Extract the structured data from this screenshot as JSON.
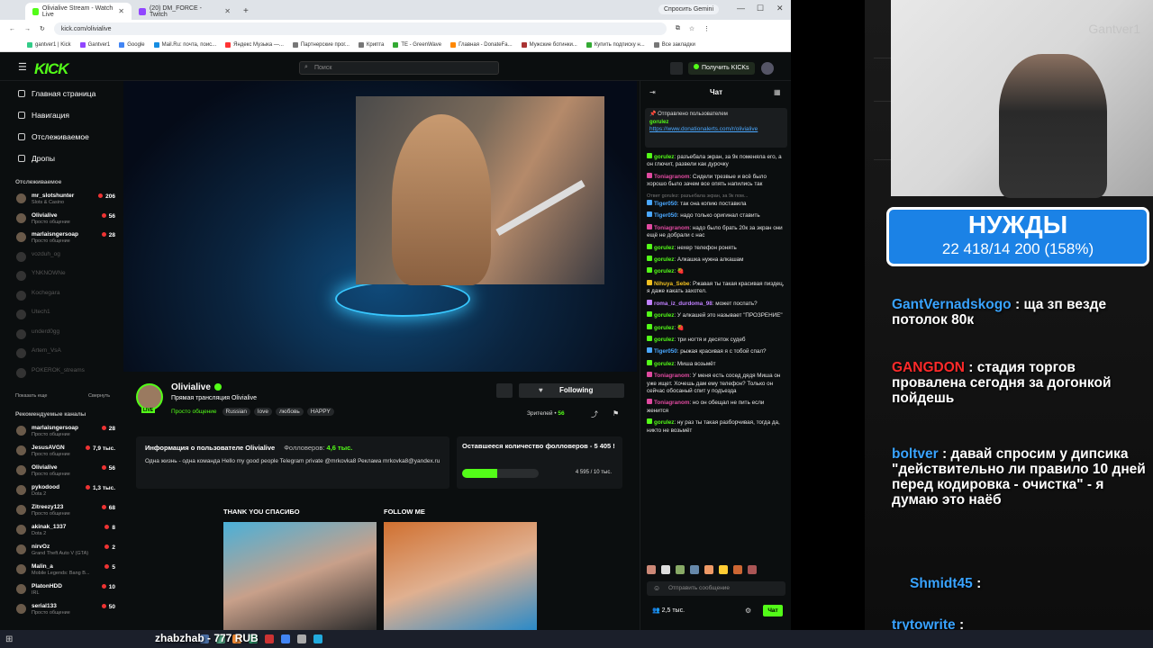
{
  "browser": {
    "tabs": [
      {
        "label": "Olivialive Stream - Watch Live",
        "color": "#53fc18"
      },
      {
        "label": "(20) DM_FORCE - Twitch",
        "color": "#9146ff"
      }
    ],
    "gemini": "Спросить Gemini",
    "url": "kick.com/olivialive",
    "bookmarks": [
      "gantver1 | Kick",
      "Gantver1",
      "Google",
      "Mail.Ru: почта, поис...",
      "Яндекс Музыка —...",
      "Партнерские прог...",
      "Крипта",
      "TE - GreenWave",
      "Главная - DonateFa...",
      "Мужские ботинки...",
      "Купить подписку н...",
      "Все закладки"
    ]
  },
  "kick": {
    "logo": "KICK",
    "search_placeholder": "Поиск",
    "get_kicks": "Получить KICKs"
  },
  "sidebar": {
    "nav": [
      "Главная страница",
      "Навигация",
      "Отслеживаемое",
      "Дропы"
    ],
    "followed_header": "Отслеживаемое",
    "followed": [
      {
        "name": "mr_slotshunter",
        "sub": "Slots & Casino",
        "count": "206",
        "live": true
      },
      {
        "name": "Olivialive",
        "sub": "Просто общение",
        "count": "56",
        "live": true
      },
      {
        "name": "marlaisngersoap",
        "sub": "Просто общение",
        "count": "28",
        "live": true
      },
      {
        "name": "vozduh_og",
        "sub": "",
        "count": "",
        "live": false
      },
      {
        "name": "YNKNOWNe",
        "sub": "",
        "count": "",
        "live": false
      },
      {
        "name": "Kochegara",
        "sub": "",
        "count": "",
        "live": false
      },
      {
        "name": "Utech1",
        "sub": "",
        "count": "",
        "live": false
      },
      {
        "name": "underd0gg",
        "sub": "",
        "count": "",
        "live": false
      },
      {
        "name": "Artem_VsA",
        "sub": "",
        "count": "",
        "live": false
      },
      {
        "name": "POKEROK_streams",
        "sub": "",
        "count": "",
        "live": false
      }
    ],
    "show_more": "Показать еще",
    "collapse": "Свернуть",
    "recommended_header": "Рекомендуемые каналы",
    "recommended": [
      {
        "name": "marlaisngersoap",
        "sub": "Просто общение",
        "count": "28"
      },
      {
        "name": "JesusAVGN",
        "sub": "Просто общение",
        "count": "7,9 тыс."
      },
      {
        "name": "Olivialive",
        "sub": "Просто общение",
        "count": "56"
      },
      {
        "name": "pykodood",
        "sub": "Dota 2",
        "count": "1,3 тыс."
      },
      {
        "name": "Zitreezy123",
        "sub": "Просто общение",
        "count": "68"
      },
      {
        "name": "akinak_1337",
        "sub": "Dota 2",
        "count": "8"
      },
      {
        "name": "nirvOz",
        "sub": "Grand Theft Auto V (GTA)",
        "count": "2"
      },
      {
        "name": "Malin_a",
        "sub": "Mobile Legends: Bang B...",
        "count": "5"
      },
      {
        "name": "PlatonHDD",
        "sub": "IRL",
        "count": "10"
      },
      {
        "name": "serial133",
        "sub": "Просто общение",
        "count": "50"
      }
    ]
  },
  "stream": {
    "name": "Olivialive",
    "live_badge": "LIVE",
    "title": "Прямая трансляция Olivialive",
    "category": "Просто общение",
    "tags": [
      "Russian",
      "love",
      "любовь",
      "HAPPY"
    ],
    "follow_label": "Following",
    "viewers_label": "Зрителей •",
    "viewers": "56",
    "about_title": "Информация о пользователе Olivialive",
    "followers_label": "Фолловеров:",
    "followers": "4,6 тыс.",
    "about_text": "Одна жизнь - одна команда Hello my good people  Telegram private @mrkovka8 Реклама mrkovka8@yandex.ru",
    "goal_title": "Оставшееся количество фолловеров - 5 405 !",
    "goal_progress": 0.46,
    "goal_num": "4 595 / 10 тыс.",
    "panel1": "THANK YOU СПАСИБО",
    "panel2": "FOLLOW ME"
  },
  "chat": {
    "title": "Чат",
    "pinned_by": "Отправлено пользователем",
    "pinned_user": "gorulez",
    "pinned_link": "https://www.donationalerts.com/r/olivialive",
    "messages": [
      {
        "user": "gorulez",
        "color": "#53fc18",
        "text": "разъебала экран, за 9к поменяла его, а он глючит, развели как дурочку"
      },
      {
        "user": "Toniagranom",
        "color": "#e04aa0",
        "text": "Сидели трезвые и всё было хорошо было зачем все опять напились так"
      },
      {
        "user": "Tiger050",
        "color": "#4aa8ff",
        "reply": "Ответ gorulez: разъебала экран, за 9к пом...",
        "text": "так она копию поставила"
      },
      {
        "user": "Tiger050",
        "color": "#4aa8ff",
        "text": "надо только оригинал ставить"
      },
      {
        "user": "Toniagranom",
        "color": "#e04aa0",
        "text": "надо было брать 20к за экран они ещё не добрали с нас"
      },
      {
        "user": "gorulez",
        "color": "#53fc18",
        "text": "нехер телефон ронять"
      },
      {
        "user": "gorulez",
        "color": "#53fc18",
        "text": "Алкашка нужна алкашам"
      },
      {
        "user": "gorulez",
        "color": "#53fc18",
        "text": "🍓"
      },
      {
        "user": "Nihuya_Sebe",
        "color": "#f0c020",
        "text": "Ржавая ты такая красивая пиздец, я даже какать захотел."
      },
      {
        "user": "roma_iz_durdoma_98",
        "color": "#c080ff",
        "text": "может поспать?"
      },
      {
        "user": "gorulez",
        "color": "#53fc18",
        "text": "У алкашей это называет \"ПРОЗРЕНИЕ\""
      },
      {
        "user": "gorulez",
        "color": "#53fc18",
        "text": "🍓"
      },
      {
        "user": "gorulez",
        "color": "#53fc18",
        "text": "три ногтя и десяток судеб"
      },
      {
        "user": "Tiger050",
        "color": "#4aa8ff",
        "text": "рыжая красивая я с тобой спал?"
      },
      {
        "user": "gorulez",
        "color": "#53fc18",
        "text": "Миша возьмёт"
      },
      {
        "user": "Toniagranom",
        "color": "#e04aa0",
        "text": "У меня есть сосед дядя Миша он уже ищет. Хочешь дам ему телефон? Только он сейчас обосаный спит у подъезда"
      },
      {
        "user": "Toniagranom",
        "color": "#e04aa0",
        "text": "но он обещал не пить если женится"
      },
      {
        "user": "gorulez",
        "color": "#53fc18",
        "text": "ну раз ты такая разборчивая, тогда да, никто не возьмёт"
      }
    ],
    "input_placeholder": "Отправить сообщение",
    "viewer_count": "2,5 тыс.",
    "send_label": "Чат"
  },
  "overlay": {
    "watermark": "Gantver1",
    "needs_title": "НУЖДЫ",
    "needs_value": "22 418/14 200 (158%)",
    "messages": [
      {
        "user": "GantVernadskogo",
        "sep": ":",
        "text": "ща зп везде потолок 80к",
        "red": false
      },
      {
        "user": "GANGDON",
        "sep": ":",
        "text": "стадия торгов провалена сегодня за догонкой пойдешь",
        "red": true
      },
      {
        "user": "boltver",
        "sep": ":",
        "text": "давай спросим у дипсика \"действительно ли правило 10 дней перед кодировка - очистка\" - я думаю это наёб",
        "red": false
      },
      {
        "user": "Shmidt45",
        "sep": ":",
        "text": "",
        "red": false
      },
      {
        "user": "trytowrite",
        "sep": ":",
        "text": "",
        "red": false
      }
    ],
    "ticker": "zhabzhab - 777 RUB"
  }
}
